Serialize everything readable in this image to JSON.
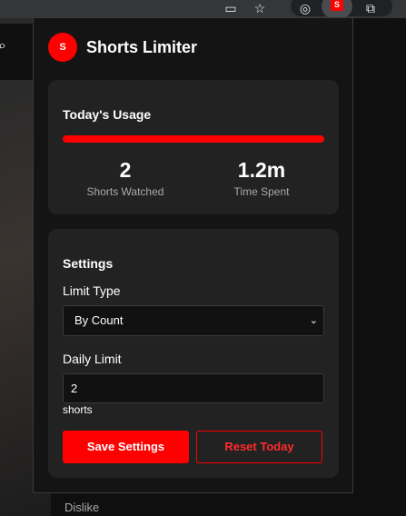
{
  "browser": {
    "icons": [
      "cast-icon",
      "star-icon",
      "extension-icon",
      "shorts-limiter-extension-icon",
      "puzzle-icon"
    ],
    "ext_badge": "S"
  },
  "background": {
    "dislike_label": "Dislike"
  },
  "popup": {
    "logo_text": "S",
    "title": "Shorts Limiter",
    "usage": {
      "heading": "Today's Usage",
      "progress_fraction": 1.0,
      "shorts_watched_value": "2",
      "shorts_watched_label": "Shorts Watched",
      "time_spent_value": "1.2m",
      "time_spent_label": "Time Spent"
    },
    "settings": {
      "heading": "Settings",
      "limit_type_label": "Limit Type",
      "limit_type_selected": "By Count",
      "daily_limit_label": "Daily Limit",
      "daily_limit_value": "2",
      "daily_limit_unit": "shorts",
      "save_label": "Save Settings",
      "reset_label": "Reset Today"
    }
  },
  "colors": {
    "accent": "#ff0000",
    "card": "#222222",
    "panel": "#141414"
  }
}
